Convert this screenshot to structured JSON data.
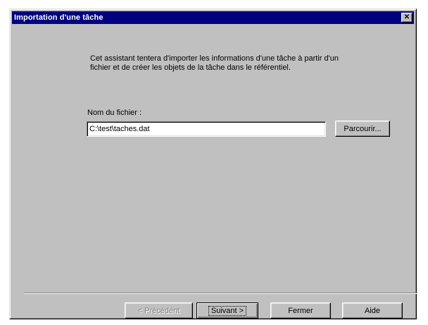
{
  "window": {
    "title": "Importation d'une tâche",
    "close_glyph": "✕"
  },
  "intro": {
    "line1": "Cet assistant tentera d'importer les informations d'une tâche à partir d'un",
    "line2": "fichier et de créer les objets de la tâche dans le référentiel."
  },
  "file": {
    "label": "Nom du fichier :",
    "value": "C:\\test\\taches.dat"
  },
  "buttons": {
    "browse": "Parcourir...",
    "previous": "< Précédent",
    "next": "Suivant >",
    "close": "Fermer",
    "help": "Aide"
  },
  "colors": {
    "titlebar": "#000080",
    "face": "#c0c0c0"
  }
}
